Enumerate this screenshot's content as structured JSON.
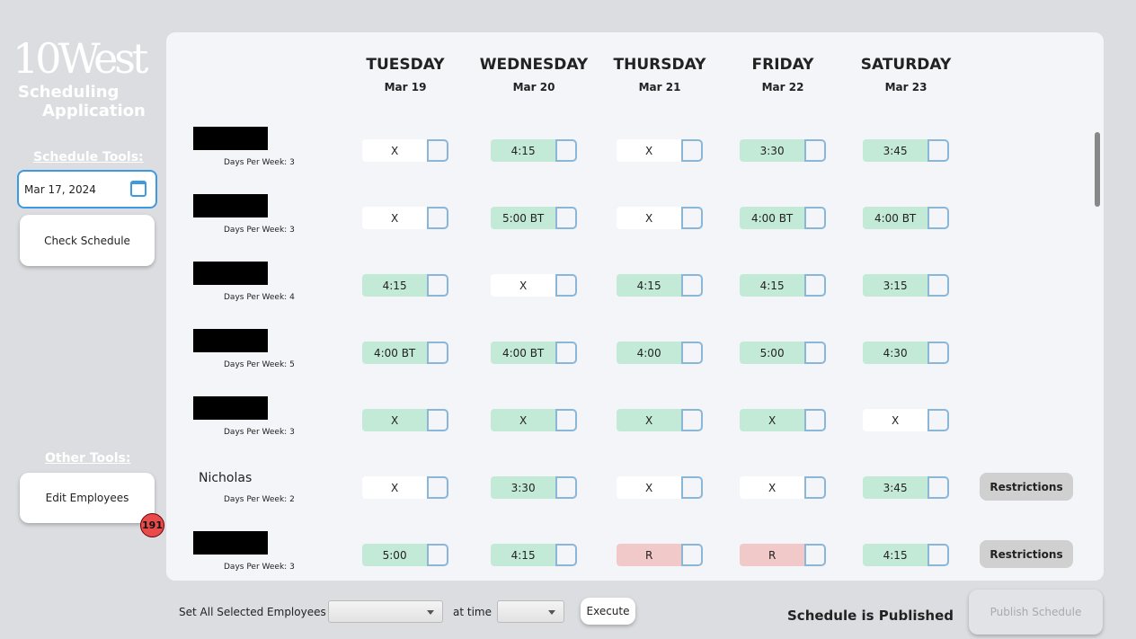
{
  "brand": {
    "logo": "10West",
    "line1": "Scheduling",
    "line2": "Application"
  },
  "sidebar": {
    "schedule_tools": "Schedule Tools:",
    "date_value": "Mar 17, 2024",
    "check_schedule": "Check Schedule",
    "other_tools": "Other Tools:",
    "edit_employees": "Edit Employees",
    "badge": "191"
  },
  "days": [
    {
      "name": "TUESDAY",
      "date": "Mar 19"
    },
    {
      "name": "WEDNESDAY",
      "date": "Mar 20"
    },
    {
      "name": "THURSDAY",
      "date": "Mar 21"
    },
    {
      "name": "FRIDAY",
      "date": "Mar 22"
    },
    {
      "name": "SATURDAY",
      "date": "Mar 23"
    }
  ],
  "colors": {
    "assigned": "#c3ead6",
    "restricted": "#f1c9c9",
    "off": "#ffffff",
    "accent": "#3d9ae0"
  },
  "rows": [
    {
      "name": "",
      "redacted": true,
      "dpw": "Days Per Week: 3",
      "cells": [
        [
          "X",
          "off"
        ],
        [
          "4:15",
          "assigned"
        ],
        [
          "X",
          "off"
        ],
        [
          "3:30",
          "assigned"
        ],
        [
          "3:45",
          "assigned"
        ]
      ]
    },
    {
      "name": "",
      "redacted": true,
      "dpw": "Days Per Week: 3",
      "cells": [
        [
          "X",
          "off"
        ],
        [
          "5:00 BT",
          "assigned"
        ],
        [
          "X",
          "off"
        ],
        [
          "4:00 BT",
          "assigned"
        ],
        [
          "4:00 BT",
          "assigned"
        ]
      ]
    },
    {
      "name": "",
      "redacted": true,
      "dpw": "Days Per Week: 4",
      "cells": [
        [
          "4:15",
          "assigned"
        ],
        [
          "X",
          "off"
        ],
        [
          "4:15",
          "assigned"
        ],
        [
          "4:15",
          "assigned"
        ],
        [
          "3:15",
          "assigned"
        ]
      ]
    },
    {
      "name": "",
      "redacted": true,
      "dpw": "Days Per Week: 5",
      "cells": [
        [
          "4:00 BT",
          "assigned"
        ],
        [
          "4:00 BT",
          "assigned"
        ],
        [
          "4:00",
          "assigned"
        ],
        [
          "5:00",
          "assigned"
        ],
        [
          "4:30",
          "assigned"
        ]
      ]
    },
    {
      "name": "",
      "redacted": true,
      "dpw": "Days Per Week: 3",
      "cells": [
        [
          "X",
          "assigned"
        ],
        [
          "X",
          "assigned"
        ],
        [
          "X",
          "assigned"
        ],
        [
          "X",
          "assigned"
        ],
        [
          "X",
          "off"
        ]
      ]
    },
    {
      "name": "Nicholas",
      "redacted": false,
      "dpw": "Days Per Week: 2",
      "cells": [
        [
          "X",
          "off"
        ],
        [
          "3:30",
          "assigned"
        ],
        [
          "X",
          "off"
        ],
        [
          "X",
          "off"
        ],
        [
          "3:45",
          "assigned"
        ]
      ],
      "restrictions": "Restrictions"
    },
    {
      "name": "",
      "redacted": true,
      "dpw": "Days Per Week: 3",
      "cells": [
        [
          "5:00",
          "assigned"
        ],
        [
          "4:15",
          "assigned"
        ],
        [
          "R",
          "restricted"
        ],
        [
          "R",
          "restricted"
        ],
        [
          "4:15",
          "assigned"
        ]
      ],
      "restrictions": "Restrictions"
    }
  ],
  "footer": {
    "set_label": "Set All Selected Employees as",
    "at_time": "at time",
    "execute": "Execute",
    "status": "Schedule is Published",
    "publish": "Publish Schedule"
  }
}
